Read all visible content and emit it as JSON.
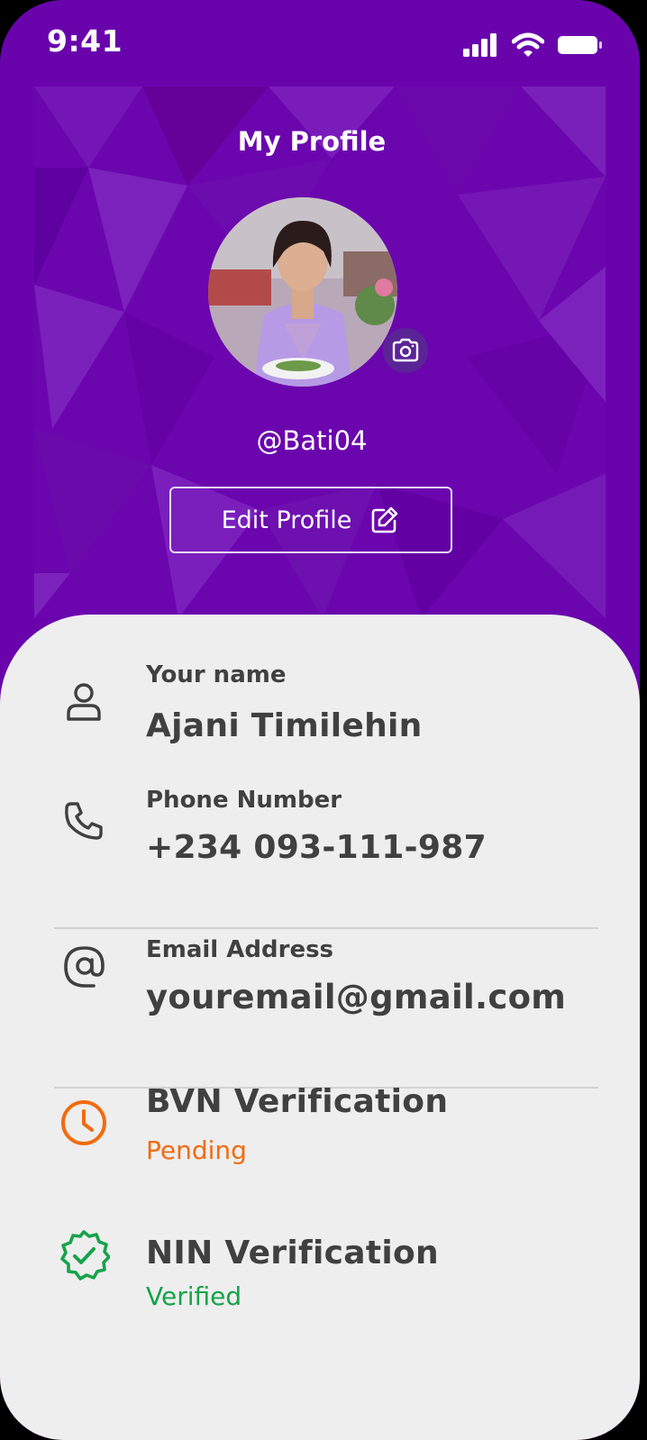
{
  "status_bar": {
    "time": "9:41"
  },
  "header": {
    "title": "My Profile",
    "handle": "@Bati04",
    "edit_button_label": "Edit Profile"
  },
  "profile": {
    "name_label": "Your name",
    "name_value": "Ajani Timilehin",
    "phone_label": "Phone Number",
    "phone_value": "+234 093-111-987",
    "email_label": "Email Address",
    "email_value": "youremail@gmail.com"
  },
  "verification": {
    "bvn_label": "BVN Verification",
    "bvn_status": "Pending",
    "nin_label": "NIN Verification",
    "nin_status": "Verified"
  },
  "colors": {
    "brand": "#6904ac",
    "pending": "#f26b0f",
    "verified": "#16a34a",
    "card": "#eeeeee",
    "text": "#404040"
  },
  "icons": [
    "signal-icon",
    "wifi-icon",
    "battery-icon",
    "camera-icon",
    "edit-icon",
    "user-icon",
    "phone-icon",
    "at-icon",
    "clock-icon",
    "verified-badge-icon"
  ]
}
